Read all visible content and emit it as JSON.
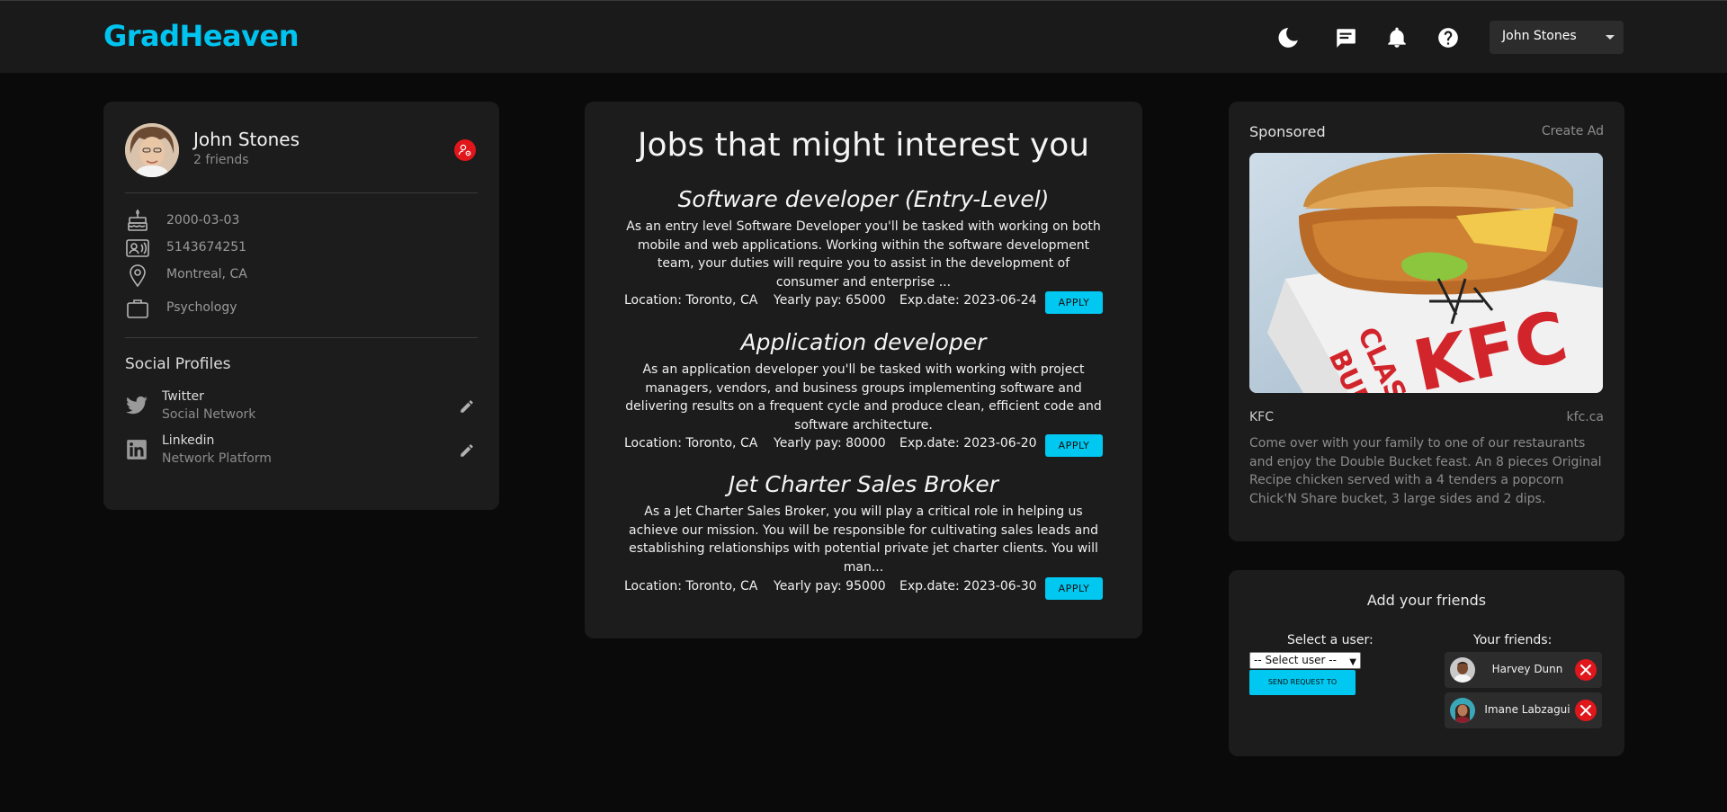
{
  "app": {
    "logo": "GradHeaven"
  },
  "navbar": {
    "icons": [
      "moon-icon",
      "chat-icon",
      "bell-icon",
      "help-icon"
    ],
    "user_menu": "John Stones"
  },
  "profile": {
    "name": "John Stones",
    "friends": "2 friends",
    "birthday": "2000-03-03",
    "phone": "5143674251",
    "location": "Montreal, CA",
    "program": "Psychology",
    "social_title": "Social Profiles",
    "socials": [
      {
        "name": "Twitter",
        "sub": "Social Network"
      },
      {
        "name": "Linkedin",
        "sub": "Network Platform"
      }
    ]
  },
  "jobs": {
    "title": "Jobs that might interest you",
    "apply_label": "APPLY",
    "items": [
      {
        "title": "Software developer (Entry-Level)",
        "desc": "As an entry level Software Developer you'll be tasked with working on both mobile and web applications. Working within the software development team, your duties will require you to assist in the development of consumer and enterprise ...",
        "location": "Location: Toronto, CA",
        "pay": "Yearly pay: 65000",
        "exp": "Exp.date: 2023-06-24"
      },
      {
        "title": "Application developer",
        "desc": "As an application developer you'll be tasked with working with project managers, vendors, and business groups implementing software and delivering results on a frequent cycle and produce clean, efficient code and software architecture.",
        "location": "Location: Toronto, CA",
        "pay": "Yearly pay: 80000",
        "exp": "Exp.date: 2023-06-20"
      },
      {
        "title": "Jet Charter Sales Broker",
        "desc": "As a Jet Charter Sales Broker, you will play a critical role in helping us achieve our mission. You will be responsible for cultivating sales leads and establishing relationships with potential private jet charter clients. You will man...",
        "location": "Location: Toronto, CA",
        "pay": "Yearly pay: 95000",
        "exp": "Exp.date: 2023-06-30"
      }
    ]
  },
  "ad": {
    "heading": "Sponsored",
    "create": "Create Ad",
    "brand": "KFC",
    "domain": "kfc.ca",
    "description": "Come over with your family to one of our restaurants and enjoy the Double Bucket feast. An 8 pieces Original Recipe chicken served with a 4 tenders a popcorn Chick'N Share bucket, 3 large sides and 2 dips.",
    "box_text_1": "CLASSIC",
    "box_text_2": "BURGER",
    "box_logo": "KFC"
  },
  "friends": {
    "title": "Add your friends",
    "select_label": "Select a user:",
    "select_value": "-- Select user --",
    "send_label": "SEND REQUEST TO",
    "your_friends_label": "Your friends:",
    "list": [
      {
        "name": "Harvey Dunn"
      },
      {
        "name": "Imane Labzagui"
      }
    ]
  },
  "colors": {
    "accent": "#00c4f0",
    "danger": "#e0161b",
    "card": "#1c1c1c",
    "background": "#0a0a0a"
  }
}
